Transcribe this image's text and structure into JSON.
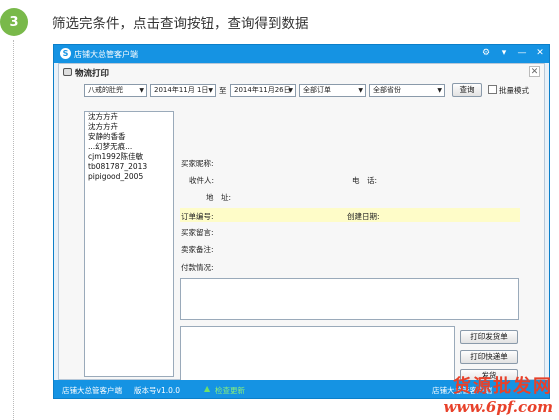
{
  "step": {
    "number": "3",
    "text": "筛选完条件，点击查询按钮，查询得到数据"
  },
  "app": {
    "title": "店铺大总管客户端",
    "dialog_title": "物流打印",
    "filters": {
      "shop": "八戒的肚兜",
      "date_from": "2014年11月 1日",
      "to_label": "至",
      "date_to": "2014年11月26日",
      "order_status": "全部订单",
      "province": "全部省份"
    },
    "query_button": "查询",
    "batch_mode_label": "批量模式",
    "buyers": [
      "沈方方卉",
      "沈方方卉",
      "安静的香香",
      "...幻梦无痕...",
      "cjm1992陈佳敏",
      "tb081787_2013",
      "pipigood_2005"
    ],
    "fields": {
      "buyer_nick": "买家昵称:",
      "receiver": "收件人:",
      "phone": "电　话:",
      "address": "地　址:",
      "order_no": "订单编号:",
      "created_date": "创建日期:",
      "buyer_message": "买家留言:",
      "seller_note": "卖家备注:",
      "payment": "付款情况:"
    },
    "actions": {
      "print_shipping": "打印发货单",
      "print_express": "打印快递单",
      "ship": "发货",
      "print_settings": "打印设置"
    },
    "statusbar": {
      "app_name": "店铺大总管客户端",
      "version": "版本号v1.0.0",
      "update": "检查更新",
      "right_text": "店铺大总管客户端"
    }
  },
  "watermark": {
    "line1": "货源批发网",
    "line2": "www.6pf.com"
  },
  "colors": {
    "titlebar": "#1593e3",
    "step_badge": "#79b94a",
    "highlight": "#fefcc8",
    "watermark": "#e8412a"
  }
}
